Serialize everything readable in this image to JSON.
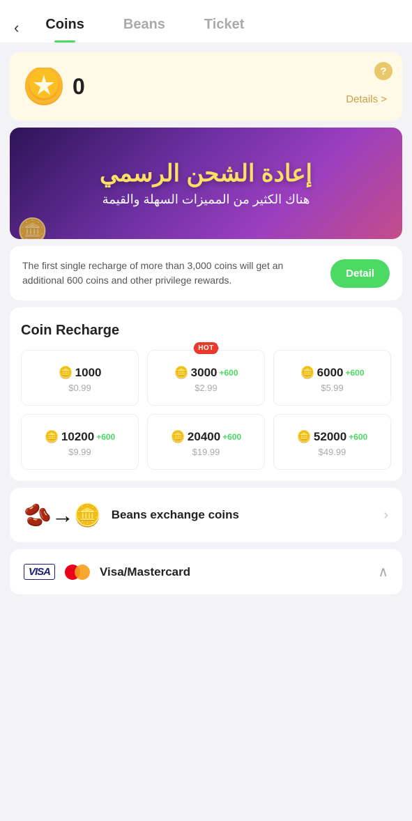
{
  "header": {
    "back_label": "‹",
    "tabs": [
      {
        "id": "coins",
        "label": "Coins",
        "active": true
      },
      {
        "id": "beans",
        "label": "Beans",
        "active": false
      },
      {
        "id": "ticket",
        "label": "Ticket",
        "active": false
      }
    ]
  },
  "balance_card": {
    "amount": "0",
    "details_label": "Details >",
    "help_label": "?"
  },
  "banner": {
    "title": "إعادة الشحن الرسمي",
    "subtitle": "هناك الكثير من المميزات السهلة والقيمة"
  },
  "promo": {
    "text": "The first single recharge of more than 3,000 coins will get an additional 600 coins and other privilege rewards.",
    "button_label": "Detail"
  },
  "coin_recharge": {
    "section_title": "Coin Recharge",
    "options": [
      {
        "amount": "1000",
        "bonus": "",
        "price": "$0.99",
        "hot": false
      },
      {
        "amount": "3000",
        "bonus": "+600",
        "price": "$2.99",
        "hot": true
      },
      {
        "amount": "6000",
        "bonus": "+600",
        "price": "$5.99",
        "hot": false
      },
      {
        "amount": "10200",
        "bonus": "+600",
        "price": "$9.99",
        "hot": false
      },
      {
        "amount": "20400",
        "bonus": "+600",
        "price": "$19.99",
        "hot": false
      },
      {
        "amount": "52000",
        "bonus": "+600",
        "price": "$49.99",
        "hot": false
      }
    ],
    "hot_label": "HOT"
  },
  "exchange": {
    "label": "Beans exchange coins",
    "icon": "🫘→🪙"
  },
  "payment": {
    "label": "Visa/Mastercard"
  }
}
